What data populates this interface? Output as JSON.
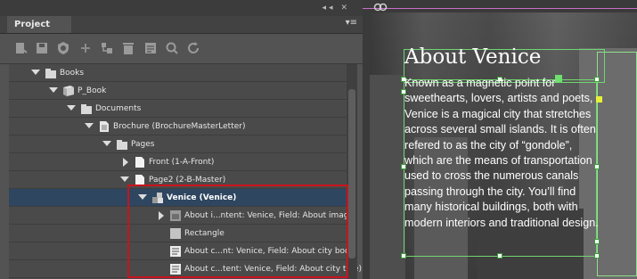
{
  "panel": {
    "tab_label": "Project",
    "collapse_glyph": "◂◂",
    "close_glyph": "✕",
    "menu_glyph": "▾≡",
    "toolbar_icons": [
      "relink-icon",
      "save-icon",
      "check-in-icon",
      "add-icon",
      "structure-icon",
      "trash-icon",
      "properties-icon",
      "find-icon",
      "refresh-icon"
    ]
  },
  "tree": {
    "rows": [
      {
        "label": "Books"
      },
      {
        "label": "P_Book"
      },
      {
        "label": "Documents"
      },
      {
        "label": "Brochure (BrochureMasterLetter)"
      },
      {
        "label": "Pages"
      },
      {
        "label": "Front (1-A-Front)"
      },
      {
        "label": "Page2 (2-B-Master)"
      },
      {
        "label": "Venice (Venice)"
      },
      {
        "label": "About i...ntent: Venice, Field: About image)"
      },
      {
        "label": "Rectangle"
      },
      {
        "label": "About c...nt: Venice, Field: About city body)"
      },
      {
        "label": "About c...tent: Venice, Field: About city title)"
      }
    ]
  },
  "document": {
    "title": "About Venice",
    "body": "Known as a magnetic point for sweethearts, lovers, artists and poets, Venice is a magical city that stretches across several small islands. It is often refered to as the city of “gondole”, which are the means of transportation used to cross the numerous canals passing through the city. You’ll find many historical buildings, both with modern interiors and traditional design."
  },
  "colors": {
    "selection_box": "#c8141e",
    "frame_guide": "#6fd66f",
    "selected_row": "#2f4660"
  }
}
